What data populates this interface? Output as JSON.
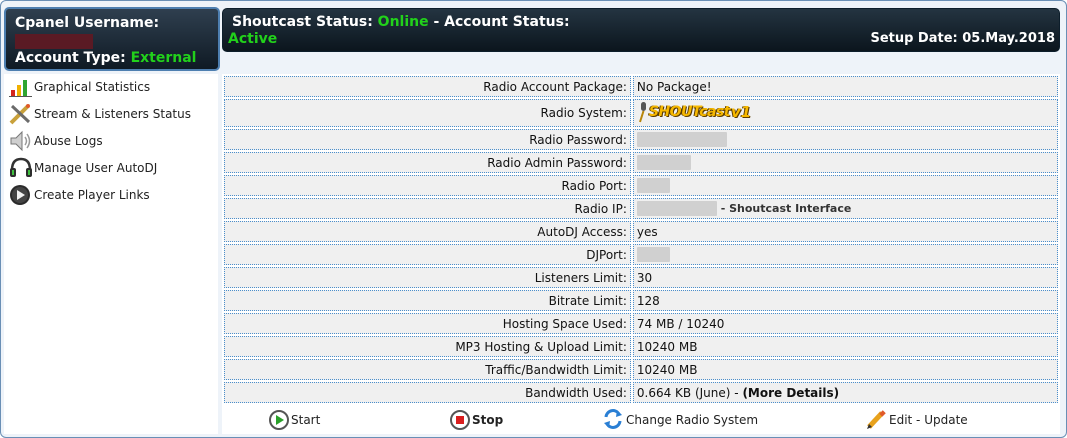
{
  "account": {
    "username_label": "Cpanel Username:",
    "type_label": "Account Type:",
    "type_value": "External"
  },
  "status": {
    "shoutcast_label": "Shoutcast Status:",
    "shoutcast_value": "Online",
    "separator": "-",
    "account_label": "Account Status:",
    "account_value": "Active",
    "setup_date": "Setup Date: 05.May.2018"
  },
  "sidebar": {
    "items": [
      {
        "label": "Graphical Statistics",
        "icon": "bar-chart-icon"
      },
      {
        "label": "Stream & Listeners Status",
        "icon": "pencil-tools-icon"
      },
      {
        "label": "Abuse Logs",
        "icon": "speaker-icon"
      },
      {
        "label": "Manage User AutoDJ",
        "icon": "headphones-icon"
      },
      {
        "label": "Create Player Links",
        "icon": "play-disc-icon"
      }
    ]
  },
  "info": {
    "package_label": "Radio Account Package:",
    "package_value": "No Package!",
    "system_label": "Radio System:",
    "system_logo_text": "SHOUTcast",
    "system_logo_version": "v1",
    "password_label": "Radio Password:",
    "admin_password_label": "Radio Admin Password:",
    "port_label": "Radio Port:",
    "ip_label": "Radio IP:",
    "ip_suffix": "- Shoutcast Interface",
    "autodj_label": "AutoDJ Access:",
    "autodj_value": "yes",
    "djport_label": "DJPort:",
    "listeners_label": "Listeners Limit:",
    "listeners_value": "30",
    "bitrate_label": "Bitrate Limit:",
    "bitrate_value": "128",
    "hosting_label": "Hosting Space Used:",
    "hosting_value": "74 MB / 10240",
    "mp3_label": "MP3 Hosting & Upload Limit:",
    "mp3_value": "10240 MB",
    "traffic_label": "Traffic/Bandwidth Limit:",
    "traffic_value": "10240 MB",
    "bandwidth_label": "Bandwidth Used:",
    "bandwidth_value": "0.664 KB (June) -",
    "bandwidth_link": "(More Details)"
  },
  "actions": {
    "start": "Start",
    "stop": "Stop",
    "change": "Change Radio System",
    "edit": "Edit - Update"
  },
  "colors": {
    "status_green": "#22d11b",
    "header_dark": "#0f1a24",
    "cell_border": "#4b8ecb"
  }
}
